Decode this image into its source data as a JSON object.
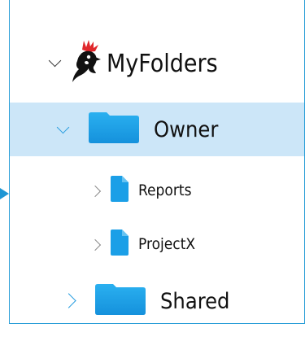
{
  "tree": {
    "root": {
      "label": "MyFolders",
      "expanded": true,
      "logo": "rooster-head-logo"
    },
    "items": [
      {
        "label": "Owner",
        "expanded": true,
        "selected": true,
        "icon": "folder-icon"
      },
      {
        "label": "Reports",
        "expanded": false,
        "selected": false,
        "icon": "file-icon"
      },
      {
        "label": "ProjectX",
        "expanded": false,
        "selected": false,
        "icon": "file-icon"
      },
      {
        "label": "Shared",
        "expanded": false,
        "selected": false,
        "icon": "folder-icon"
      }
    ]
  },
  "colors": {
    "accent": "#2b9fd8",
    "selection": "#cce6f8",
    "folder": "#1b9fe7",
    "chevron_blue": "#2a9ee0",
    "chevron_gray": "#8a8a8a",
    "logo_red": "#e0282c"
  }
}
